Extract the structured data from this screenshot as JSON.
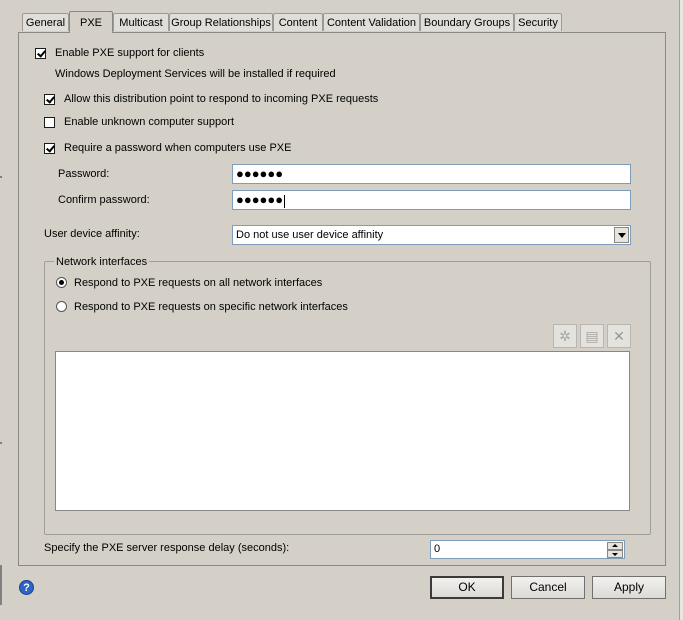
{
  "tabs": [
    {
      "label": "General"
    },
    {
      "label": "PXE"
    },
    {
      "label": "Multicast"
    },
    {
      "label": "Group Relationships"
    },
    {
      "label": "Content"
    },
    {
      "label": "Content Validation"
    },
    {
      "label": "Boundary Groups"
    },
    {
      "label": "Security"
    }
  ],
  "active_tab": "PXE",
  "pxe": {
    "enable_pxe": {
      "label": "Enable PXE support for clients",
      "checked": true
    },
    "wds_note": "Windows Deployment Services will be installed if required",
    "allow_respond": {
      "label": "Allow this distribution point to respond to incoming PXE requests",
      "checked": true
    },
    "unknown_support": {
      "label": "Enable unknown computer support",
      "checked": false
    },
    "require_password": {
      "label": "Require a password when computers use PXE",
      "checked": true
    },
    "password": {
      "label": "Password:",
      "value": "●●●●●●"
    },
    "confirm_password": {
      "label": "Confirm password:",
      "value": "●●●●●●"
    },
    "affinity": {
      "label": "User device affinity:",
      "value": "Do not use user device affinity"
    }
  },
  "network": {
    "title": "Network interfaces",
    "all_interfaces": {
      "label": "Respond to PXE requests on all network interfaces",
      "selected": true
    },
    "specific_interfaces": {
      "label": "Respond to PXE requests on specific network interfaces",
      "selected": false
    },
    "toolbar": {
      "new_icon": "✲",
      "properties_icon": "▤",
      "delete_icon": "✕"
    }
  },
  "delay": {
    "label": "Specify the PXE server response delay (seconds):",
    "value": "0"
  },
  "buttons": {
    "ok": "OK",
    "cancel": "Cancel",
    "apply": "Apply"
  },
  "help_icon": "?"
}
